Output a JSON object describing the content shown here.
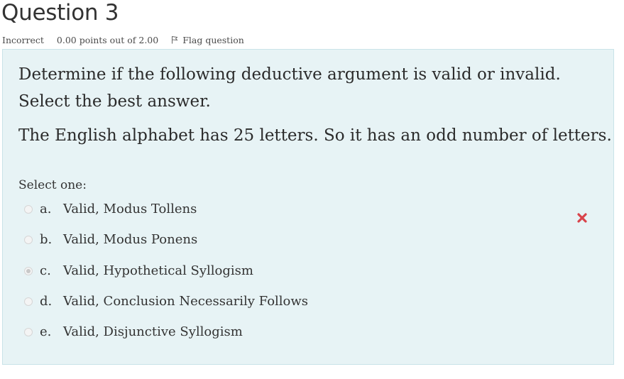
{
  "question": {
    "heading": "Question 3",
    "state": "Incorrect",
    "grade": "0.00 points out of 2.00",
    "flag_label": "Flag question"
  },
  "content": {
    "line1": "Determine if the following deductive argument is valid or invalid.",
    "line2": "Select the best answer.",
    "premise": "The English alphabet has 25 letters.  So it has an odd number of letters.",
    "prompt": "Select one:"
  },
  "answers": [
    {
      "letter": "a.",
      "text": "Valid, Modus Tollens",
      "selected": false
    },
    {
      "letter": "b.",
      "text": "Valid, Modus Ponens",
      "selected": false
    },
    {
      "letter": "c.",
      "text": "Valid, Hypothetical Syllogism",
      "selected": true
    },
    {
      "letter": "d.",
      "text": "Valid, Conclusion Necessarily Follows",
      "selected": false
    },
    {
      "letter": "e.",
      "text": "Valid, Disjunctive Syllogism",
      "selected": false
    }
  ],
  "colors": {
    "box_background": "#e7f3f5",
    "incorrect_mark": "#d9434a"
  }
}
